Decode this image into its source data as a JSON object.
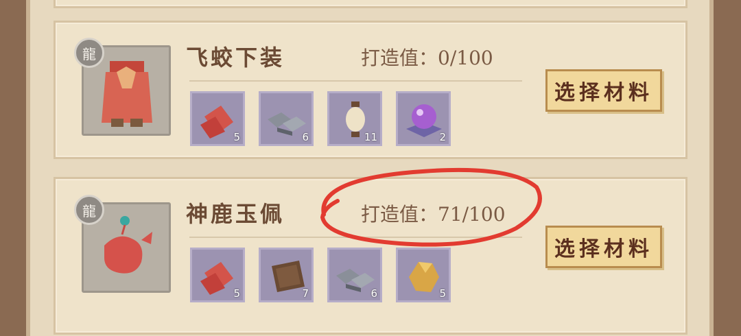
{
  "cards": [
    {
      "name": "飞蛟下装",
      "forge_label": "打造值",
      "forge_value": "0/100",
      "button_label": "选择材料",
      "materials": [
        {
          "icon": "cloth-bolt-icon",
          "count": "5"
        },
        {
          "icon": "iron-ingot-icon",
          "count": "6"
        },
        {
          "icon": "thread-spool-icon",
          "count": "11"
        },
        {
          "icon": "purple-orb-icon",
          "count": "2"
        }
      ]
    },
    {
      "name": "神鹿玉佩",
      "forge_label": "打造值",
      "forge_value": "71/100",
      "button_label": "选择材料",
      "materials": [
        {
          "icon": "cloth-bolt-icon",
          "count": "5"
        },
        {
          "icon": "fur-pelt-icon",
          "count": "7"
        },
        {
          "icon": "iron-ingot-icon",
          "count": "6"
        },
        {
          "icon": "gold-ore-icon",
          "count": "5"
        }
      ]
    }
  ],
  "colors": {
    "annotation": "#e23b30",
    "material_bg": "#9c93b1",
    "button_bg": "#f1d89c"
  }
}
